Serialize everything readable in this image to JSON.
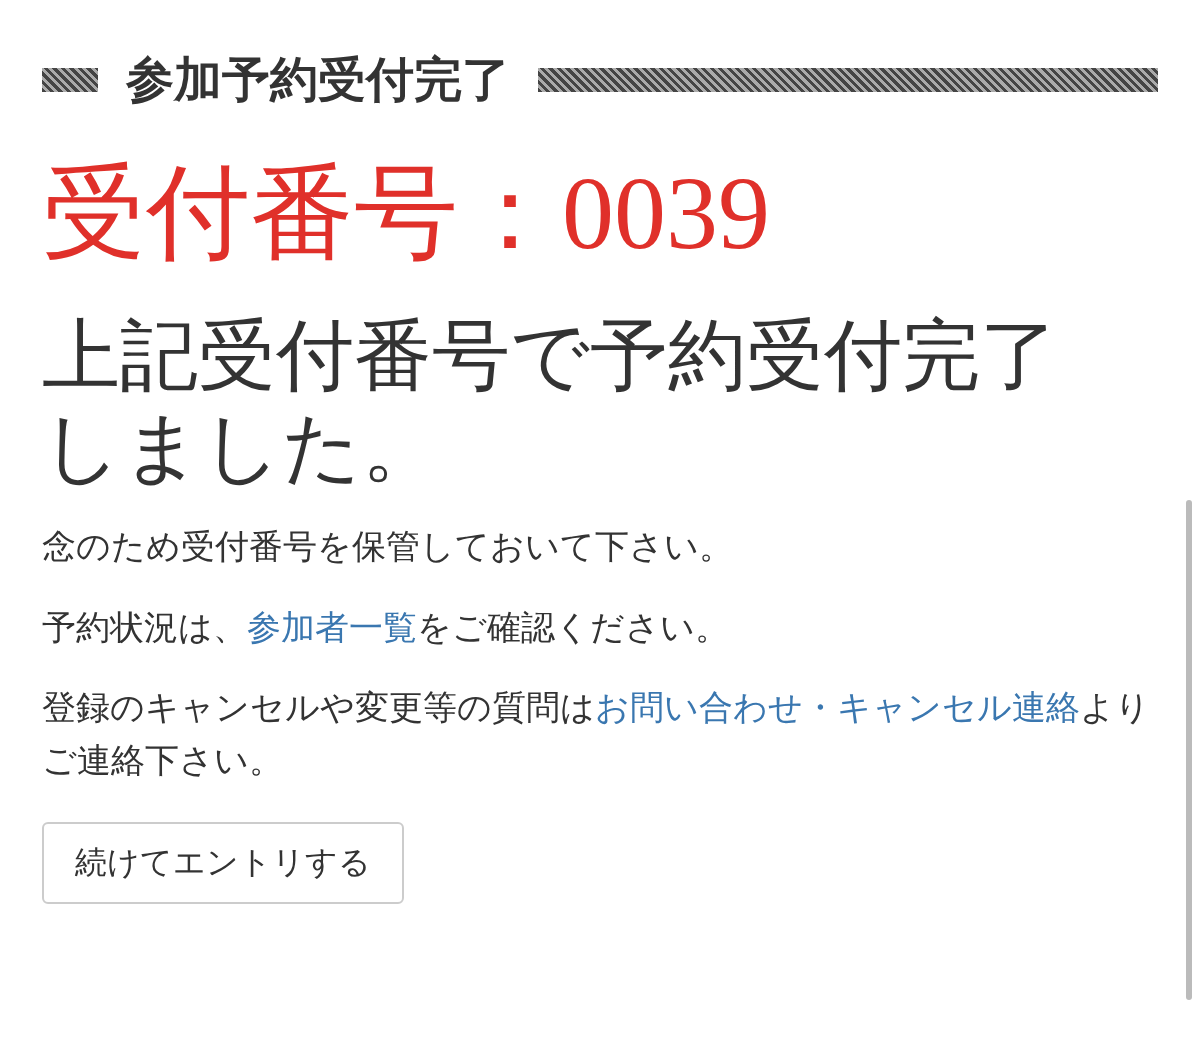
{
  "heading": "参加予約受付完了",
  "receipt": {
    "label": "受付番号：",
    "number": "0039"
  },
  "headline": "上記受付番号で予約受付完了しました。",
  "paragraphs": [
    [
      {
        "text": "念のため受付番号を保管しておいて下さい。",
        "link": false
      }
    ],
    [
      {
        "text": "予約状況は、",
        "link": false
      },
      {
        "text": "参加者一覧",
        "link": true
      },
      {
        "text": "をご確認ください。",
        "link": false
      }
    ],
    [
      {
        "text": "登録のキャンセルや変更等の質問は",
        "link": false
      },
      {
        "text": "お問い合わせ・キャンセル連絡",
        "link": true
      },
      {
        "text": "よりご連絡下さい。",
        "link": false
      }
    ]
  ],
  "button": "続けてエントリする"
}
